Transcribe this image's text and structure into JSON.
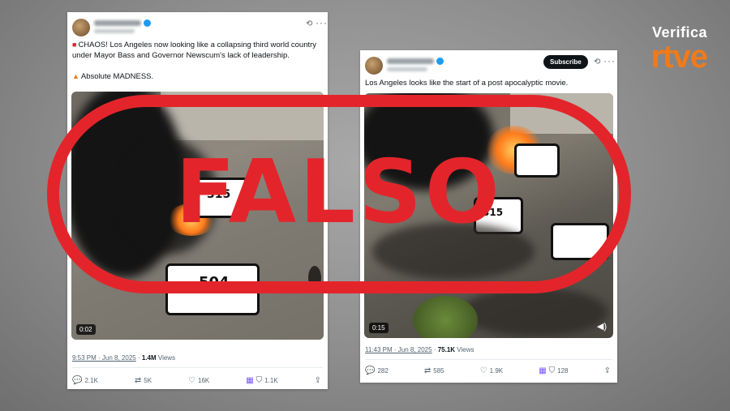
{
  "brand": {
    "top": "Verifica",
    "logo": "rtve"
  },
  "stamp": {
    "text": "FALSO",
    "color": "#e3252b"
  },
  "tweets": [
    {
      "id": "left",
      "text_line1": "CHAOS! Los Angeles now looking like a collapsing third world country under Mayor Bass and Governor Newscum's lack of leadership.",
      "text_line2": "Absolute MADNESS.",
      "video_time": "0:02",
      "car_number": "504",
      "car_number_top": "315",
      "timestamp": "9:53 PM · Jun 8, 2025",
      "views_count": "1.4M",
      "views_label": "Views",
      "replies": "2.1K",
      "reposts": "5K",
      "likes": "16K",
      "bookmarks": "1.1K"
    },
    {
      "id": "right",
      "subscribe_label": "Subscribe",
      "text_line1": "Los Angeles looks like the start of a post apocalyptic movie.",
      "video_time": "0:15",
      "car_number": "315",
      "timestamp": "11:43 PM · Jun 8, 2025",
      "views_count": "75.1K",
      "views_label": "Views",
      "replies": "282",
      "reposts": "585",
      "likes": "1.9K",
      "bookmarks": "128"
    }
  ],
  "icons": {
    "reply": "reply-icon",
    "repost": "repost-icon",
    "like": "heart-icon",
    "bookmark": "bookmark-icon",
    "share": "share-icon"
  }
}
